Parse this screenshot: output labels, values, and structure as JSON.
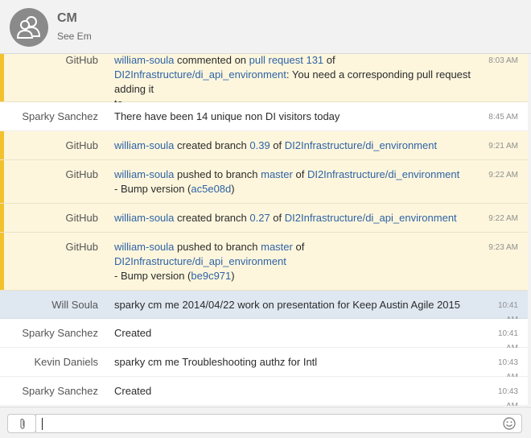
{
  "room": {
    "initials": "CM",
    "name": "CM",
    "topic": "See Em"
  },
  "colors": {
    "bot_bg": "#fdf6dd",
    "bot_accent": "#f2c12e",
    "link": "#2f63a5",
    "selected_bg": "#dfe8f1"
  },
  "messages": [
    {
      "kind": "bot",
      "sender": "GitHub",
      "time": "8:03 AM",
      "parts": [
        {
          "t": "william-soula",
          "link": true
        },
        {
          "t": " commented on "
        },
        {
          "t": "pull request 131",
          "link": true
        },
        {
          "t": " of "
        },
        {
          "br": true
        },
        {
          "t": "DI2Infrastructure/di_api_environment",
          "link": true
        },
        {
          "t": ": You need a corresponding pull request adding it "
        },
        {
          "br": true
        },
        {
          "t": "to..."
        }
      ]
    },
    {
      "kind": "human",
      "sender": "Sparky Sanchez",
      "time": "8:45 AM",
      "parts": [
        {
          "t": "There have been 14 unique non DI visitors today"
        }
      ]
    },
    {
      "kind": "bot",
      "sender": "GitHub",
      "time": "9:21 AM",
      "parts": [
        {
          "t": "william-soula",
          "link": true
        },
        {
          "t": " created branch "
        },
        {
          "t": "0.39",
          "link": true
        },
        {
          "t": " of "
        },
        {
          "t": "DI2Infrastructure/di_environment",
          "link": true
        }
      ]
    },
    {
      "kind": "bot",
      "sender": "GitHub",
      "time": "9:22 AM",
      "parts": [
        {
          "t": "william-soula",
          "link": true
        },
        {
          "t": " pushed to branch "
        },
        {
          "t": "master",
          "link": true
        },
        {
          "t": " of "
        },
        {
          "t": "DI2Infrastructure/di_environment",
          "link": true
        },
        {
          "br": true
        },
        {
          "t": "- Bump version ("
        },
        {
          "t": "ac5e08d",
          "link": true
        },
        {
          "t": ")"
        }
      ]
    },
    {
      "kind": "bot",
      "sender": "GitHub",
      "time": "9:22 AM",
      "parts": [
        {
          "t": "william-soula",
          "link": true
        },
        {
          "t": " created branch "
        },
        {
          "t": "0.27",
          "link": true
        },
        {
          "t": " of "
        },
        {
          "t": "DI2Infrastructure/di_api_environment",
          "link": true
        }
      ]
    },
    {
      "kind": "bot",
      "sender": "GitHub",
      "time": "9:23 AM",
      "parts": [
        {
          "t": "william-soula",
          "link": true
        },
        {
          "t": " pushed to branch "
        },
        {
          "t": "master",
          "link": true
        },
        {
          "t": " of "
        },
        {
          "br": true
        },
        {
          "t": "DI2Infrastructure/di_api_environment",
          "link": true
        },
        {
          "br": true
        },
        {
          "t": "- Bump version ("
        },
        {
          "t": "be9c971",
          "link": true
        },
        {
          "t": ")"
        }
      ]
    },
    {
      "kind": "selected",
      "sender": "Will Soula",
      "time": "10:41 AM",
      "parts": [
        {
          "t": "sparky cm me 2014/04/22 work on presentation for Keep Austin Agile 2015"
        }
      ]
    },
    {
      "kind": "human",
      "sender": "Sparky Sanchez",
      "time": "10:41 AM",
      "parts": [
        {
          "t": "Created"
        }
      ]
    },
    {
      "kind": "human",
      "sender": "Kevin Daniels",
      "time": "10:43 AM",
      "parts": [
        {
          "t": "sparky cm me Troubleshooting authz for Intl"
        }
      ]
    },
    {
      "kind": "human",
      "sender": "Sparky Sanchez",
      "time": "10:43 AM",
      "parts": [
        {
          "t": "Created"
        }
      ]
    }
  ],
  "composer": {
    "value": "",
    "placeholder": "",
    "attach_icon": "paperclip-icon",
    "emoji_icon": "smiley-icon"
  }
}
